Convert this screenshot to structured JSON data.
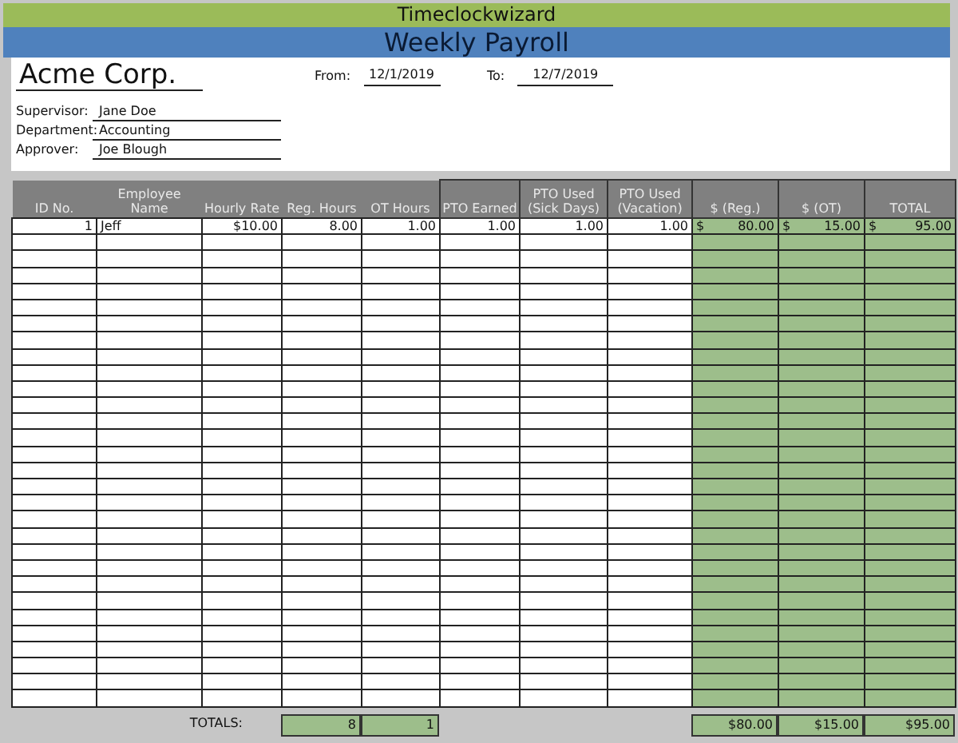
{
  "title": "Timeclockwizard",
  "subtitle": "Weekly Payroll",
  "company": "Acme Corp.",
  "period": [
    {
      "label": "From:",
      "value": "12/1/2019"
    },
    {
      "label": "To:",
      "value": "12/7/2019"
    }
  ],
  "people": [
    {
      "label": "Supervisor:",
      "value": "Jane Doe"
    },
    {
      "label": "Department:",
      "value": "Accounting"
    },
    {
      "label": "Approver:",
      "value": "Joe Blough"
    }
  ],
  "table": {
    "columns": [
      {
        "label": "ID No.",
        "kind": "plain"
      },
      {
        "label": "Employee Name",
        "kind": "plain"
      },
      {
        "label": "Hourly Rate",
        "kind": "plain"
      },
      {
        "label": "Reg. Hours",
        "kind": "plain"
      },
      {
        "label": "OT Hours",
        "kind": "plain"
      },
      {
        "label": "PTO Earned",
        "kind": "boxed"
      },
      {
        "label": "PTO Used (Sick Days)",
        "kind": "boxed"
      },
      {
        "label": "PTO Used (Vacation)",
        "kind": "boxed"
      },
      {
        "label": "$ (Reg.)",
        "kind": "money"
      },
      {
        "label": "$ (OT)",
        "kind": "money"
      },
      {
        "label": "TOTAL",
        "kind": "money"
      }
    ],
    "rows": [
      {
        "cells": [
          "1",
          "Jeff",
          "$10.00",
          "8.00",
          "1.00",
          "1.00",
          "1.00",
          "1.00",
          {
            "symbol": "$",
            "amount": "80.00"
          },
          {
            "symbol": "$",
            "amount": "15.00"
          },
          {
            "symbol": "$",
            "amount": "95.00"
          }
        ]
      }
    ]
  },
  "totals": {
    "label": "TOTALS:",
    "hours": [
      "8",
      "1"
    ],
    "amounts": [
      "$80.00",
      "$15.00",
      "$95.00"
    ]
  }
}
